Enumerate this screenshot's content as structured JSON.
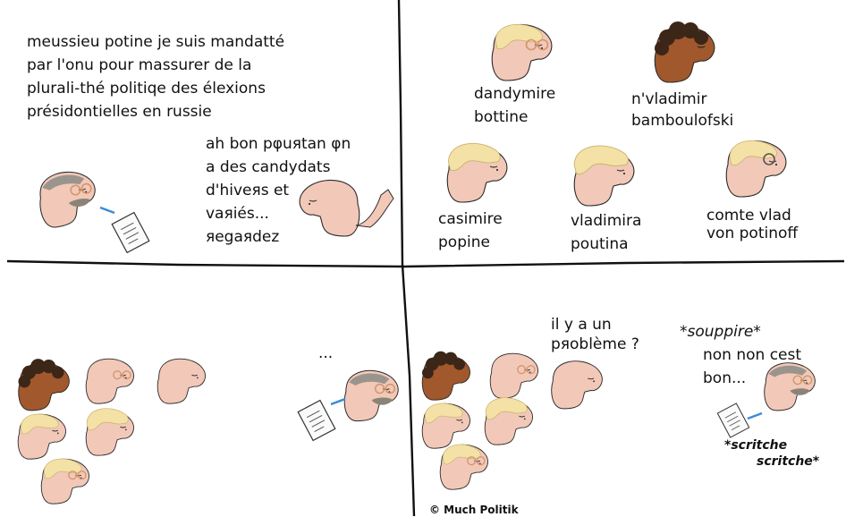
{
  "panel1": {
    "speech_lines": [
      "meussieu potine je suis mandatté",
      "par l'onu pour massurer de la",
      "plurali-thé politiqe des élexions",
      "présidontielles en russie"
    ],
    "reply_lines": [
      "ah bon pφuяtan φn",
      "a des candydats",
      "d'hiveяs et",
      "vaяiés...",
      "яegaяdez"
    ]
  },
  "panel2": {
    "candidates": [
      {
        "line1": "dandymire",
        "line2": "bottine"
      },
      {
        "line1": "n'vladimir",
        "line2": "bamboulofski"
      },
      {
        "line1": "casimire",
        "line2": "popine"
      },
      {
        "line1": "vladimira",
        "line2": "poutina"
      },
      {
        "line1": "comte vlad",
        "line2": "von potinoff"
      }
    ]
  },
  "panel3": {
    "ellipsis": "..."
  },
  "panel4": {
    "question_lines": [
      "il y a un",
      "pяoblème ?"
    ],
    "sigh": "*souppire*",
    "answer_lines": [
      "non non cest",
      "bon..."
    ],
    "scratch_lines": [
      "*scritche",
      "scritche*"
    ],
    "credit": "© Much Politik"
  },
  "colors": {
    "skin": "#f2c8b8",
    "blond_hair": "#f3e1a6",
    "dark_skin": "#a0582c",
    "dark_hair": "#3b2618",
    "grey_hair": "#9a958c",
    "glasses": "#d2956a",
    "pen": "#3c8bd6"
  }
}
